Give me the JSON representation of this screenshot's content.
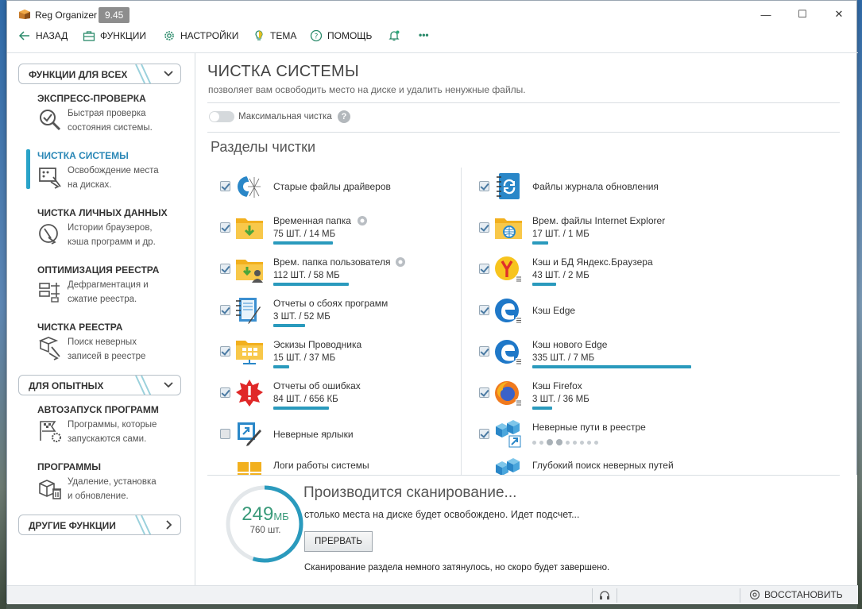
{
  "window": {
    "title": "Reg Organizer",
    "version": "9.45",
    "controls": {
      "minimize": "—",
      "maximize": "☐",
      "close": "✕"
    }
  },
  "toolbar": {
    "back": "НАЗАД",
    "functions": "ФУНКЦИИ",
    "settings": "НАСТРОЙКИ",
    "theme": "ТЕМА",
    "help": "ПОМОЩЬ",
    "more": "•••"
  },
  "sidebar": {
    "group_all": "ФУНКЦИИ ДЛЯ ВСЕХ",
    "group_adv": "ДЛЯ ОПЫТНЫХ",
    "group_other": "ДРУГИЕ ФУНКЦИИ",
    "items": [
      {
        "title": "ЭКСПРЕСС-ПРОВЕРКА",
        "desc1": "Быстрая проверка",
        "desc2": "состояния системы."
      },
      {
        "title": "ЧИСТКА СИСТЕМЫ",
        "desc1": "Освобождение места",
        "desc2": "на дисках."
      },
      {
        "title": "ЧИСТКА ЛИЧНЫХ ДАННЫХ",
        "desc1": "Истории браузеров,",
        "desc2": "кэша программ и др."
      },
      {
        "title": "ОПТИМИЗАЦИЯ РЕЕСТРА",
        "desc1": "Дефрагментация и",
        "desc2": "сжатие реестра."
      },
      {
        "title": "ЧИСТКА РЕЕСТРА",
        "desc1": "Поиск неверных",
        "desc2": "записей в реестре"
      },
      {
        "title": "АВТОЗАПУСК ПРОГРАММ",
        "desc1": "Программы, которые",
        "desc2": "запускаются сами."
      },
      {
        "title": "ПРОГРАММЫ",
        "desc1": "Удаление, установка",
        "desc2": "и обновление."
      }
    ]
  },
  "main": {
    "title": "ЧИСТКА СИСТЕМЫ",
    "subtitle": "позволяет вам освободить место на диске и удалить ненужные файлы.",
    "max_clean_label": "Максимальная чистка",
    "section_title": "Разделы чистки",
    "left_items": [
      {
        "name": "Старые файлы драйверов",
        "stat": "",
        "checked": true,
        "bar": 0
      },
      {
        "name": "Временная папка",
        "stat": "75 ШТ. / 14 МБ",
        "checked": true,
        "bar": 0.15
      },
      {
        "name": "Врем. папка пользователя",
        "stat": "112 ШТ. / 58 МБ",
        "checked": true,
        "bar": 0.19
      },
      {
        "name": "Отчеты о сбоях программ",
        "stat": "3 ШТ. / 52 МБ",
        "checked": true,
        "bar": 0.08
      },
      {
        "name": "Эскизы Проводника",
        "stat": "15 ШТ. / 37 МБ",
        "checked": true,
        "bar": 0.04
      },
      {
        "name": "Отчеты об ошибках",
        "stat": "84 ШТ. / 656 КБ",
        "checked": true,
        "bar": 0.14
      },
      {
        "name": "Неверные ярлыки",
        "stat": "",
        "checked": false,
        "bar": 0
      },
      {
        "name": "Логи работы системы",
        "stat": "",
        "checked": true,
        "bar": 0
      }
    ],
    "right_items": [
      {
        "name": "Файлы журнала обновления",
        "stat": "",
        "checked": true,
        "bar": 0
      },
      {
        "name": "Врем. файлы Internet Explorer",
        "stat": "17 ШТ. / 1 МБ",
        "checked": true,
        "bar": 0.04
      },
      {
        "name": "Кэш и БД Яндекс.Браузера",
        "stat": "43 ШТ. / 2 МБ",
        "checked": true,
        "bar": 0.06
      },
      {
        "name": "Кэш Edge",
        "stat": "",
        "checked": true,
        "bar": 0
      },
      {
        "name": "Кэш нового Edge",
        "stat": "335 ШТ. / 7 МБ",
        "checked": true,
        "bar": 0.4
      },
      {
        "name": "Кэш Firefox",
        "stat": "3 ШТ. / 36 МБ",
        "checked": true,
        "bar": 0.05
      },
      {
        "name": "Неверные пути в реестре",
        "stat": "",
        "checked": true,
        "bar": 0
      },
      {
        "name": "Глубокий поиск неверных путей",
        "stat": "",
        "checked": true,
        "bar": 0
      }
    ]
  },
  "scan": {
    "size_value": "249",
    "size_unit": "МБ",
    "count": "760 шт.",
    "title": "Производится сканирование...",
    "subtitle": "столько места на диске будет освобождено. Идет подсчет...",
    "stop_label": "ПРЕРВАТЬ",
    "note": "Сканирование раздела немного затянулось, но скоро будет завершено.",
    "progress": 0.55
  },
  "status": {
    "restore": "ВОССТАНОВИТЬ"
  },
  "colors": {
    "accent": "#2a9abd",
    "active_text": "#2a87b6",
    "ring": "#3a9a7a"
  }
}
